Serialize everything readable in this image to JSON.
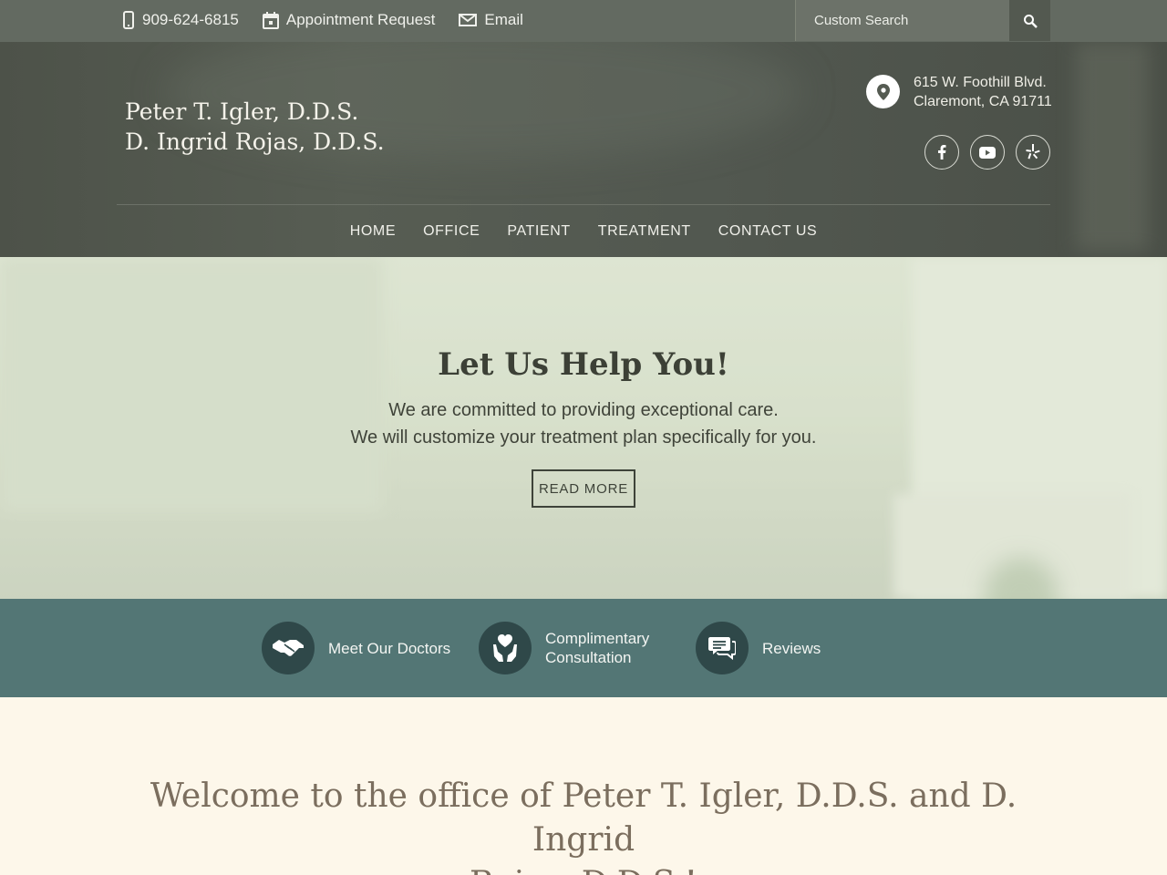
{
  "topbar": {
    "phone": "909-624-6815",
    "appointment": "Appointment Request",
    "email": "Email",
    "search_placeholder": "Custom Search",
    "icons": {
      "phone": "mobile-phone-icon",
      "appointment": "calendar-icon",
      "email": "envelope-icon",
      "search": "search-icon"
    }
  },
  "header": {
    "logo_line1": "Peter T. Igler, D.D.S.",
    "logo_line2": "D. Ingrid Rojas, D.D.S.",
    "address_line1": "615 W. Foothill Blvd.",
    "address_line2": "Claremont, CA 91711",
    "socials": [
      "facebook-icon",
      "youtube-icon",
      "yelp-icon"
    ]
  },
  "nav": {
    "items": [
      "HOME",
      "OFFICE",
      "PATIENT",
      "TREATMENT",
      "CONTACT US"
    ]
  },
  "hero": {
    "title": "Let Us Help You!",
    "line1": "We are committed to providing exceptional care.",
    "line2": "We will customize your treatment plan specifically for you.",
    "button": "READ MORE"
  },
  "features": {
    "doctors": "Meet Our Doctors",
    "consult_line1": "Complimentary",
    "consult_line2": "Consultation",
    "reviews": "Reviews",
    "icons": [
      "handshake-icon",
      "heart-hands-icon",
      "chat-bubbles-icon"
    ]
  },
  "welcome": {
    "line1": "Welcome to the office of Peter T. Igler, D.D.S. and D. Ingrid",
    "line2": "Rojas, D.D.S.!"
  },
  "colors": {
    "topbar": "#636a61",
    "header": "#525850",
    "band": "#537675",
    "icon_circle": "#2f4849",
    "welcome_bg": "#fdf7ea",
    "welcome_text": "#7b6e5e"
  }
}
